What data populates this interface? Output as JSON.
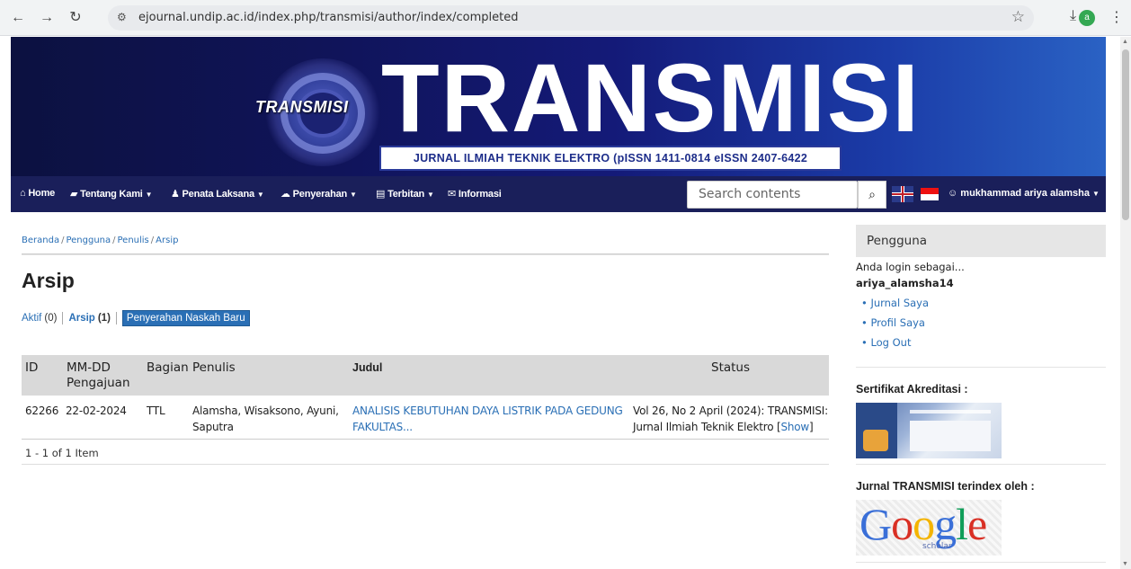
{
  "browser": {
    "url": "ejournal.undip.ac.id/index.php/transmisi/author/index/completed",
    "profile_initial": "a"
  },
  "banner": {
    "small_logo": "TRANSMISI",
    "big_title": "TRANSMISI",
    "subtitle": "JURNAL ILMIAH TEKNIK ELEKTRO (pISSN 1411-0814 eISSN 2407-6422"
  },
  "navbar": {
    "items": [
      {
        "label": "Home",
        "icon": "home-icon"
      },
      {
        "label": "Tentang Kami",
        "icon": "book-icon"
      },
      {
        "label": "Penata Laksana",
        "icon": "user-icon"
      },
      {
        "label": "Penyerahan",
        "icon": "cloud-upload-icon"
      },
      {
        "label": "Terbitan",
        "icon": "document-icon"
      },
      {
        "label": "Informasi",
        "icon": "megaphone-icon"
      }
    ],
    "search_placeholder": "Search contents",
    "user_label": "mukhammad ariya alamsha"
  },
  "breadcrumb": [
    "Beranda",
    "Pengguna",
    "Penulis",
    "Arsip"
  ],
  "page_title": "Arsip",
  "tabs": {
    "aktif_label": "Aktif",
    "aktif_count": "(0)",
    "arsip_label": "Arsip",
    "arsip_count": "(1)",
    "new_submission": "Penyerahan Naskah Baru"
  },
  "table": {
    "headers": {
      "id": "ID",
      "date_line1": "MM-DD",
      "date_line2": "Pengajuan",
      "section": "Bagian",
      "authors": "Penulis",
      "title": "Judul",
      "status": "Status"
    },
    "rows": [
      {
        "id": "62266",
        "date": "22-02-2024",
        "section": "TTL",
        "authors_line1": "Alamsha, Wisaksono, Ayuni,",
        "authors_line2": "Saputra",
        "title_line1": "ANALISIS KEBUTUHAN DAYA LISTRIK PADA GEDUNG",
        "title_line2": "FAKULTAS...",
        "status_line1": "Vol 26, No 2 April (2024): TRANSMISI:",
        "status_line2": "Jurnal Ilmiah Teknik Elektro [",
        "status_show": "Show",
        "status_close": "]"
      }
    ],
    "footer": "1 - 1 of 1 Item"
  },
  "sidebar": {
    "head": "Pengguna",
    "login_as": "Anda login sebagai...",
    "username": "ariya_alamsha14",
    "links": [
      "• Jurnal Saya",
      "• Profil Saya",
      "• Log Out"
    ],
    "cert_title": "Sertifikat Akreditasi :",
    "index_title": "Jurnal TRANSMISI terindex oleh :",
    "google_scholar": "scholar"
  }
}
